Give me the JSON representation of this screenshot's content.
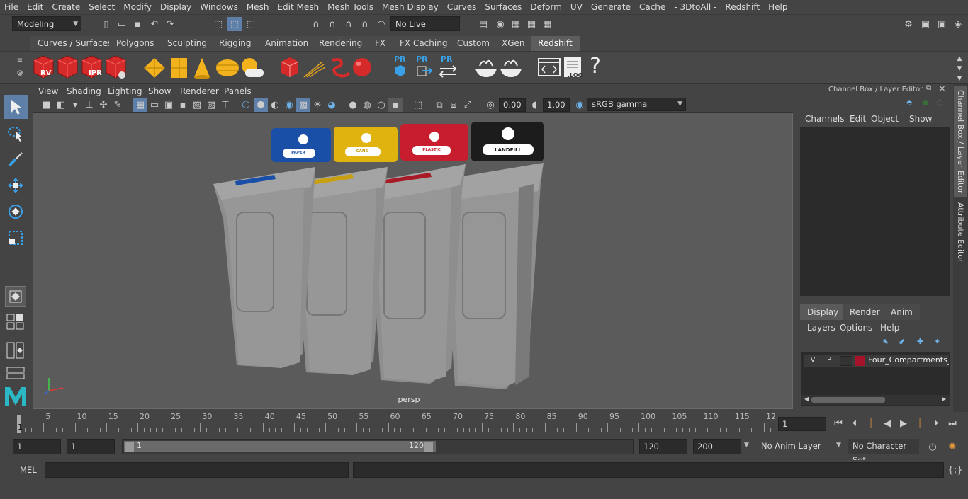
{
  "menubar": [
    "File",
    "Edit",
    "Create",
    "Select",
    "Modify",
    "Display",
    "Windows",
    "Mesh",
    "Edit Mesh",
    "Mesh Tools",
    "Mesh Display",
    "Curves",
    "Surfaces",
    "Deform",
    "UV",
    "Generate",
    "Cache",
    "- 3DtoAll -",
    "Redshift",
    "Help"
  ],
  "status": {
    "workspace": "Modeling",
    "live_surface": "No Live Surface"
  },
  "shelf_tabs": [
    "Curves / Surfaces",
    "Polygons",
    "Sculpting",
    "Rigging",
    "Animation",
    "Rendering",
    "FX",
    "FX Caching",
    "Custom",
    "XGen",
    "Redshift"
  ],
  "shelf_active": "Redshift",
  "shelf_icons": {
    "rv": "RV",
    "ipr": "IPR",
    "pr": "PR",
    "log": ".LOG",
    "help": "?"
  },
  "viewport": {
    "menu": [
      "View",
      "Shading",
      "Lighting",
      "Show",
      "Renderer",
      "Panels"
    ],
    "exposure": "0.00",
    "gamma": "1.00",
    "colorspace": "sRGB gamma",
    "camera": "persp",
    "bins": [
      {
        "label": "PAPER",
        "color": "#1a4fa8"
      },
      {
        "label": "CANS",
        "color": "#e0b30f"
      },
      {
        "label": "PLASTIC",
        "color": "#c81d2e"
      },
      {
        "label": "LANDFILL",
        "color": "#1c1c1c"
      }
    ]
  },
  "channel_box": {
    "title": "Channel Box / Layer Editor",
    "menu": [
      "Channels",
      "Edit",
      "Object",
      "Show"
    ],
    "layer_tabs": [
      "Display",
      "Render",
      "Anim"
    ],
    "layer_tab_active": "Display",
    "layer_menu": [
      "Layers",
      "Options",
      "Help"
    ],
    "layer": {
      "v": "V",
      "p": "P",
      "name": "Four_Compartments_R",
      "color": "#a8132c"
    }
  },
  "side_tabs": [
    "Channel Box / Layer Editor",
    "Attribute Editor"
  ],
  "timeline": {
    "labels": [
      "5",
      "10",
      "15",
      "20",
      "25",
      "30",
      "35",
      "40",
      "45",
      "50",
      "55",
      "60",
      "65",
      "70",
      "75",
      "80",
      "85",
      "90",
      "95",
      "100",
      "105",
      "110",
      "115",
      "12"
    ],
    "start_marker": "1",
    "current_frame": "1"
  },
  "range": {
    "start": "1",
    "playback_start": "1",
    "slider_start": "1",
    "slider_end": "120",
    "playback_end": "120",
    "end": "200",
    "anim_layer": "No Anim Layer",
    "character_set": "No Character Set"
  },
  "cmd": {
    "label": "MEL"
  }
}
